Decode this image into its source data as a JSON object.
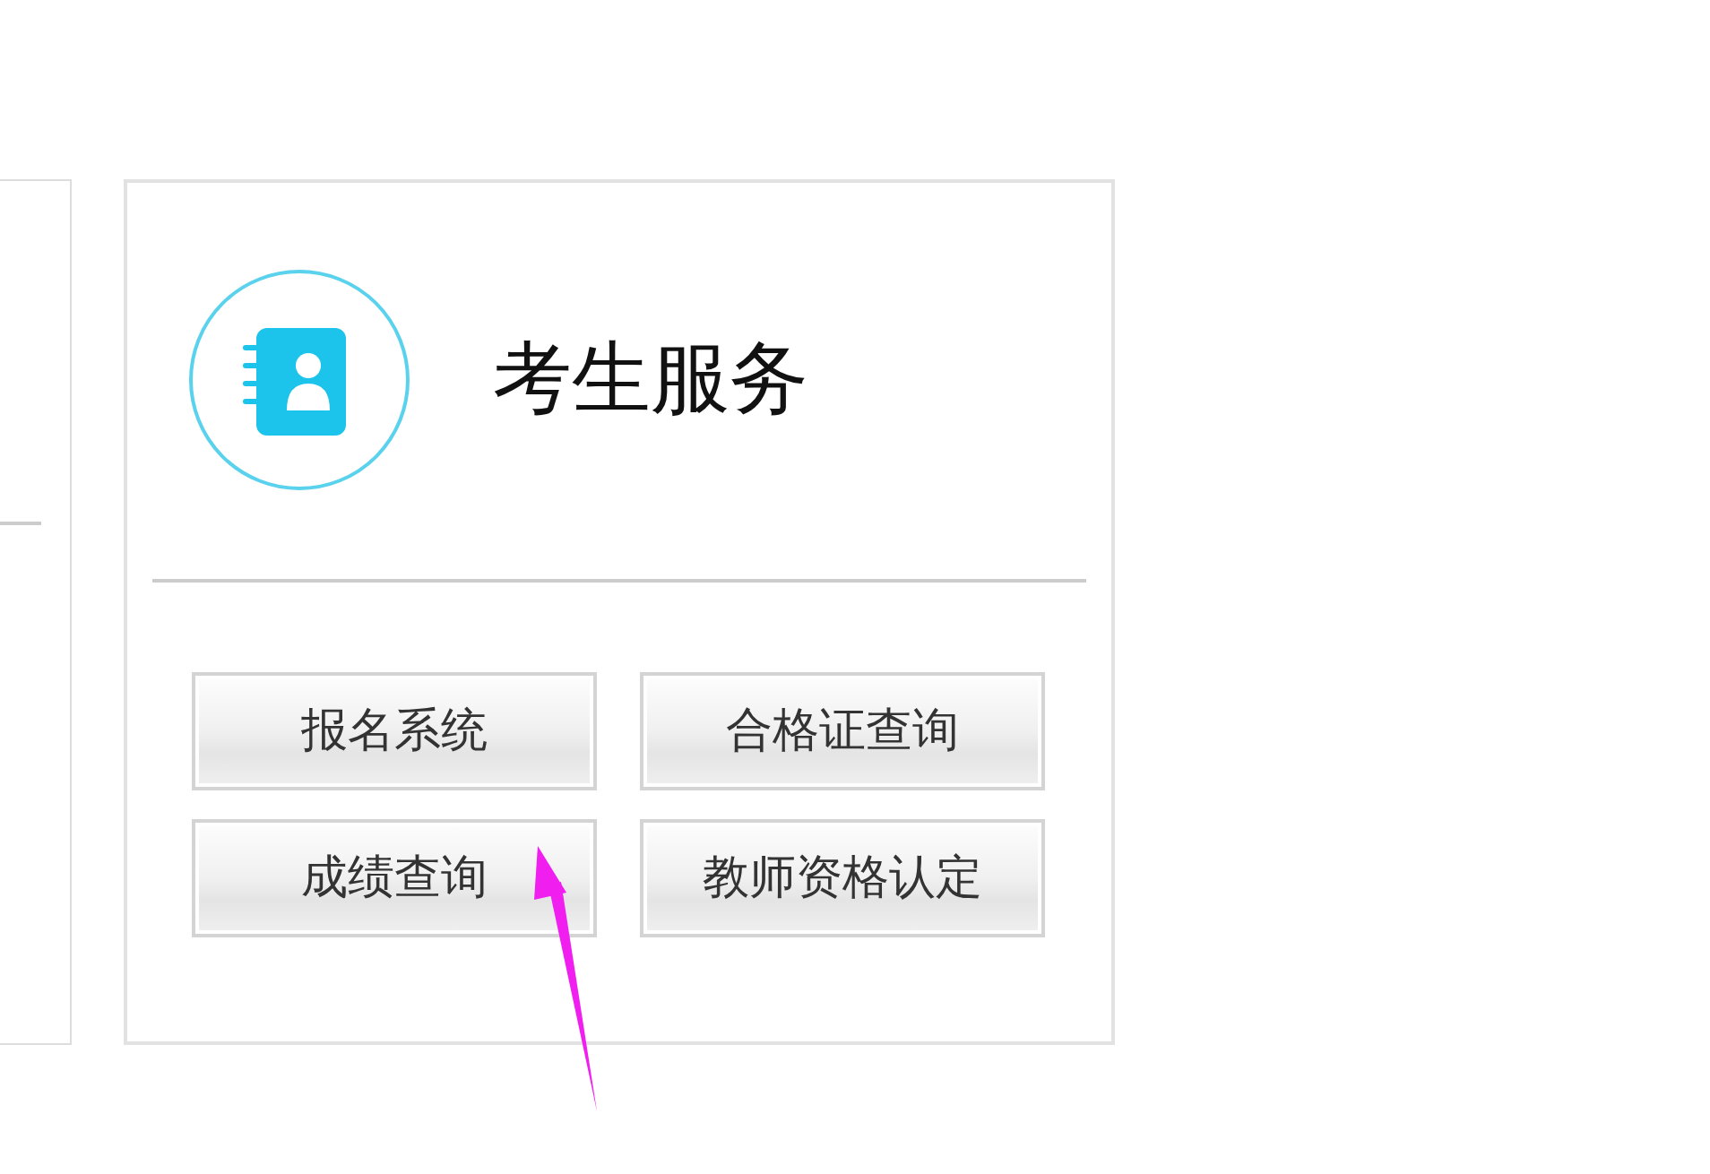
{
  "service_card": {
    "title": "考生服务",
    "buttons": [
      {
        "label": "报名系统"
      },
      {
        "label": "合格证查询"
      },
      {
        "label": "成绩查询"
      },
      {
        "label": "教师资格认定"
      }
    ]
  }
}
